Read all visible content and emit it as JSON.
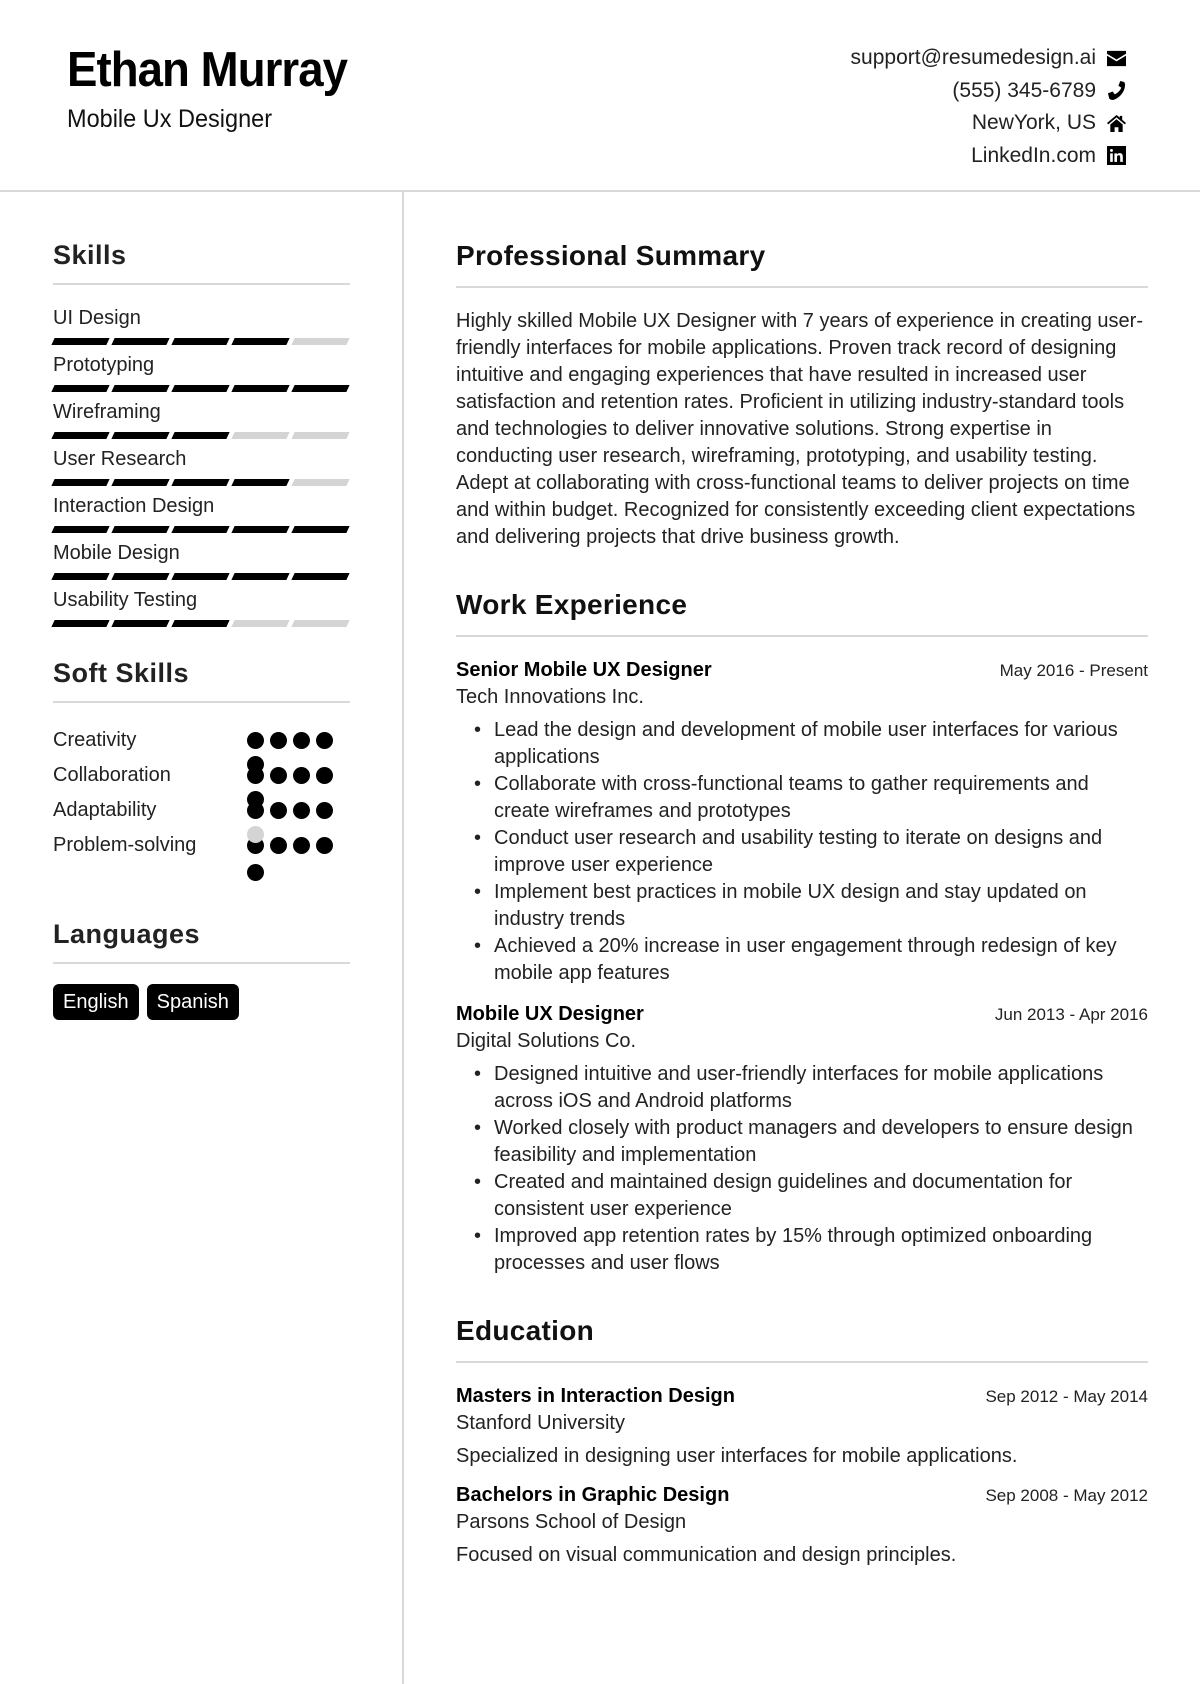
{
  "header": {
    "name": "Ethan Murray",
    "title": "Mobile Ux Designer",
    "contacts": [
      {
        "text": "support@resumedesign.ai",
        "icon": "envelope-icon"
      },
      {
        "text": "(555) 345-6789",
        "icon": "phone-icon"
      },
      {
        "text": "NewYork, US",
        "icon": "home-icon"
      },
      {
        "text": "LinkedIn.com",
        "icon": "linkedin-icon"
      }
    ]
  },
  "sidebar": {
    "skills_heading": "Skills",
    "skills": [
      {
        "name": "UI Design",
        "level": 4,
        "max": 5
      },
      {
        "name": "Prototyping",
        "level": 5,
        "max": 5
      },
      {
        "name": "Wireframing",
        "level": 3,
        "max": 5
      },
      {
        "name": "User Research",
        "level": 4,
        "max": 5
      },
      {
        "name": "Interaction Design",
        "level": 5,
        "max": 5
      },
      {
        "name": "Mobile Design",
        "level": 5,
        "max": 5
      },
      {
        "name": "Usability Testing",
        "level": 3,
        "max": 5
      }
    ],
    "soft_skills_heading": "Soft Skills",
    "soft_skills": [
      {
        "name": "Creativity",
        "level": 5,
        "max": 5
      },
      {
        "name": "Collaboration",
        "level": 5,
        "max": 5
      },
      {
        "name": "Adaptability",
        "level": 4,
        "max": 5
      },
      {
        "name": "Problem-solving",
        "level": 5,
        "max": 5
      }
    ],
    "languages_heading": "Languages",
    "languages": [
      "English",
      "Spanish"
    ]
  },
  "main": {
    "summary_heading": "Professional Summary",
    "summary": "Highly skilled Mobile UX Designer with 7 years of experience in creating user-friendly interfaces for mobile applications. Proven track record of designing intuitive and engaging experiences that have resulted in increased user satisfaction and retention rates. Proficient in utilizing industry-standard tools and technologies to deliver innovative solutions. Strong expertise in conducting user research, wireframing, prototyping, and usability testing. Adept at collaborating with cross-functional teams to deliver projects on time and within budget. Recognized for consistently exceeding client expectations and delivering projects that drive business growth.",
    "experience_heading": "Work Experience",
    "jobs": [
      {
        "title": "Senior Mobile UX Designer",
        "dates": "May 2016 - Present",
        "company": "Tech Innovations Inc.",
        "bullets": [
          "Lead the design and development of mobile user interfaces for various applications",
          "Collaborate with cross-functional teams to gather requirements and create wireframes and prototypes",
          "Conduct user research and usability testing to iterate on designs and improve user experience",
          "Implement best practices in mobile UX design and stay updated on industry trends",
          "Achieved a 20% increase in user engagement through redesign of key mobile app features"
        ]
      },
      {
        "title": "Mobile UX Designer",
        "dates": "Jun 2013 - Apr 2016",
        "company": "Digital Solutions Co.",
        "bullets": [
          "Designed intuitive and user-friendly interfaces for mobile applications across iOS and Android platforms",
          "Worked closely with product managers and developers to ensure design feasibility and implementation",
          "Created and maintained design guidelines and documentation for consistent user experience",
          "Improved app retention rates by 15% through optimized onboarding processes and user flows"
        ]
      }
    ],
    "education_heading": "Education",
    "education": [
      {
        "degree": "Masters in Interaction Design",
        "dates": "Sep 2012 - May 2014",
        "school": "Stanford University",
        "description": "Specialized in designing user interfaces for mobile applications."
      },
      {
        "degree": "Bachelors in Graphic Design",
        "dates": "Sep 2008 - May 2012",
        "school": "Parsons School of Design",
        "description": "Focused on visual communication and design principles."
      }
    ]
  }
}
